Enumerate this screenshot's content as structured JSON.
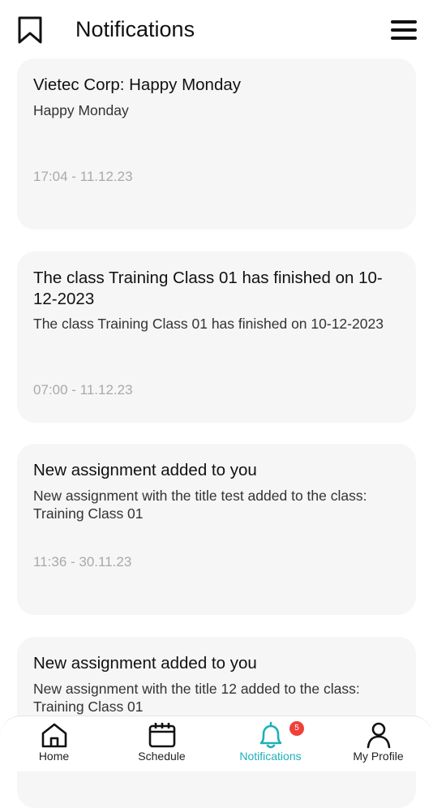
{
  "header": {
    "title": "Notifications",
    "left_icon": "bookmark-icon",
    "right_icon": "hamburger-menu-icon"
  },
  "notifications": [
    {
      "title": "Vietec Corp: Happy Monday",
      "body": "Happy Monday",
      "time": "17:04 - 11.12.23"
    },
    {
      "title": "The class Training Class 01 has finished on 10-12-2023",
      "body": "The class Training Class 01 has finished on 10-12-2023",
      "time": "07:00 - 11.12.23"
    },
    {
      "title": "New assignment added to you",
      "body": "New assignment with the title test added to the class: Training Class 01",
      "time": "11:36 - 30.11.23"
    },
    {
      "title": "New assignment added to you",
      "body": "New assignment with the title 12 added to the class: Training Class 01",
      "time": ""
    }
  ],
  "tabbar": {
    "tabs": [
      {
        "label": "Home",
        "icon": "home-icon"
      },
      {
        "label": "Schedule",
        "icon": "calendar-icon"
      },
      {
        "label": "Notifications",
        "icon": "bell-icon"
      },
      {
        "label": "My Profile",
        "icon": "user-icon"
      }
    ],
    "active": "Notifications",
    "notification_badge": "5"
  },
  "colors": {
    "accent": "#1fb0b7",
    "badge": "#f0403a",
    "card_bg": "#f6f6f6",
    "time_text": "#a9a9a9"
  }
}
